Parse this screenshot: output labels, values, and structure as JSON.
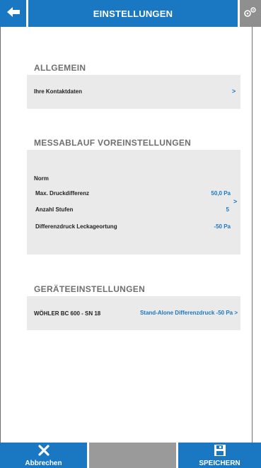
{
  "header": {
    "title": "EINSTELLUNGEN"
  },
  "sections": {
    "allgemein": {
      "title": "ALLGEMEIN",
      "contact_label": "Ihre Kontaktdaten",
      "chevron": ">"
    },
    "messablauf": {
      "title": "MESSABLAUF VOREINSTELLUNGEN",
      "norm_label": "Norm",
      "rows": [
        {
          "label": "Max. Druckdifferenz",
          "value": "50,0 Pa"
        },
        {
          "label": "Anzahl Stufen",
          "value": "5"
        },
        {
          "label": "Differenzdruck Leckageortung",
          "value": "-50 Pa"
        }
      ],
      "chevron": ">"
    },
    "geraete": {
      "title": "GERÄTEEINSTELLUNGEN",
      "device_label": "WÖHLER BC 600 - SN 18",
      "device_value": "Stand-Alone Differenzdruck -50 Pa >"
    }
  },
  "footer": {
    "cancel_label": "Abbrechen",
    "save_label": "SPEICHERN"
  },
  "icons": {
    "back": "back-arrow-icon",
    "gear": "gears-icon",
    "cancel": "close-icon",
    "save": "floppy-disk-icon"
  },
  "colors": {
    "accent": "#1a78c2",
    "gray_button": "#9a9a9a",
    "card_bg": "#eaeaea",
    "section_title": "#6f6f6f"
  }
}
